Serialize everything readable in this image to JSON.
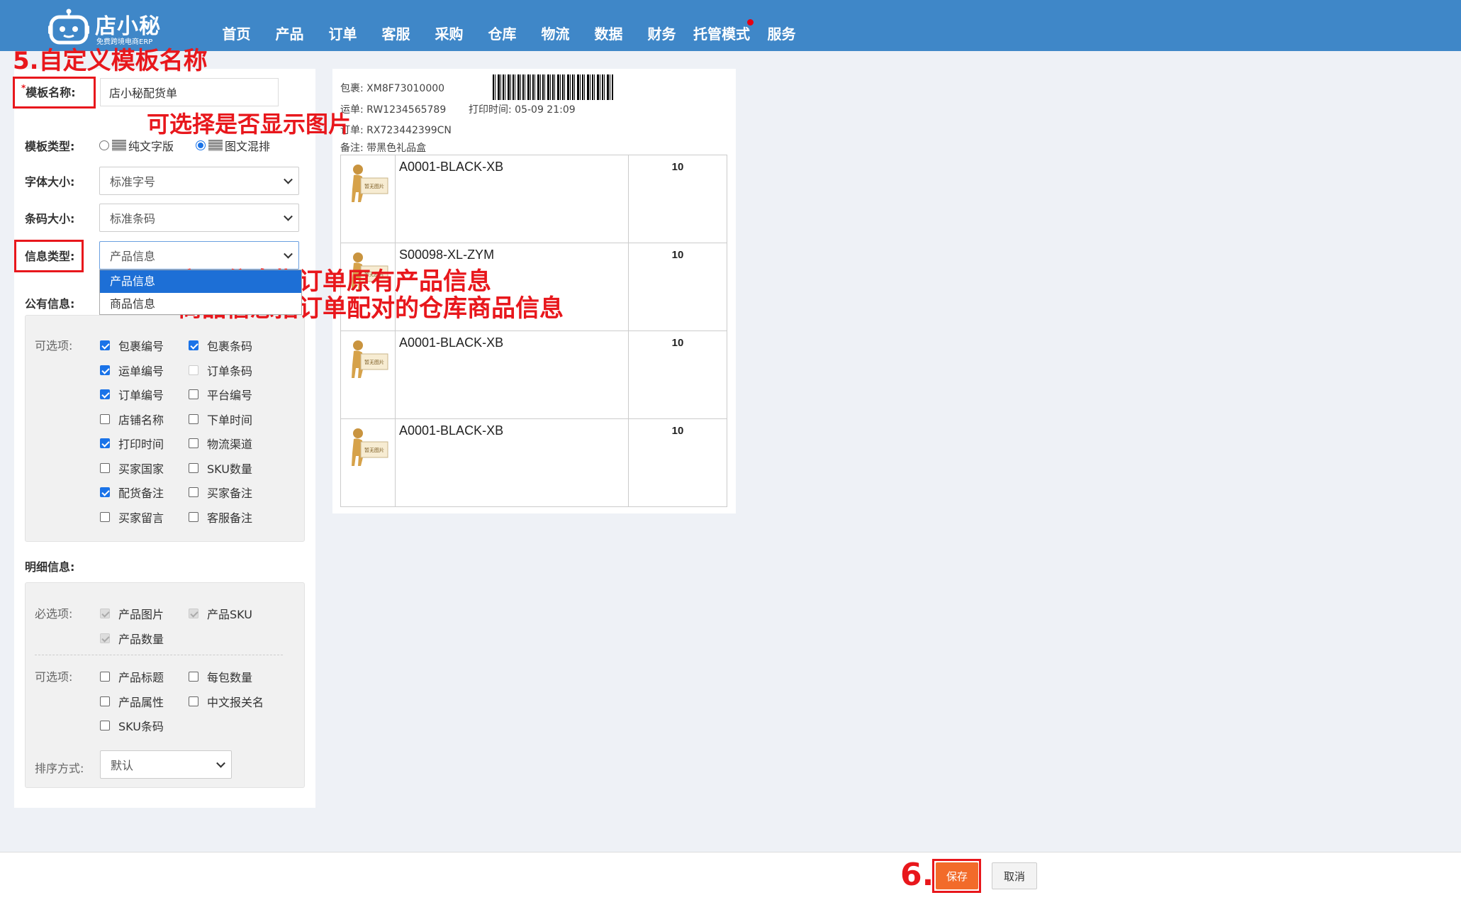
{
  "logo": {
    "name": "店小秘",
    "tagline": "免费跨境电商ERP"
  },
  "nav": [
    {
      "label": "首页"
    },
    {
      "label": "产品"
    },
    {
      "label": "订单"
    },
    {
      "label": "客服"
    },
    {
      "label": "采购"
    },
    {
      "label": "仓库"
    },
    {
      "label": "物流"
    },
    {
      "label": "数据"
    },
    {
      "label": "财务"
    },
    {
      "label": "托管模式",
      "dot": true
    },
    {
      "label": "服务"
    }
  ],
  "annotations": {
    "step5": "5.自定义模板名称",
    "show_image": "可选择是否显示图片",
    "info_line1": "产品信息指订单原有产品信息",
    "info_line2": "商品信息指订单配对的仓库商品信息",
    "step6": "6."
  },
  "form": {
    "template_name_label": "模板名称:",
    "template_name_required": "*",
    "template_name_value": "店小秘配货单",
    "template_type_label": "模板类型:",
    "template_type_options": [
      "纯文字版",
      "图文混排"
    ],
    "template_type_selected": "图文混排",
    "font_size_label": "字体大小:",
    "font_size_value": "标准字号",
    "barcode_size_label": "条码大小:",
    "barcode_size_value": "标准条码",
    "info_type_label": "信息类型:",
    "info_type_value": "产品信息",
    "info_type_options": [
      "产品信息",
      "商品信息"
    ],
    "public_info_label": "公有信息:",
    "public_optional_label": "可选项:",
    "public_options": [
      {
        "label": "包裹编号",
        "checked": true
      },
      {
        "label": "包裹条码",
        "checked": true
      },
      {
        "label": "运单编号",
        "checked": true
      },
      {
        "label": "订单条码",
        "checked": false
      },
      {
        "label": "订单编号",
        "checked": true
      },
      {
        "label": "平台编号",
        "checked": false
      },
      {
        "label": "店铺名称",
        "checked": false
      },
      {
        "label": "下单时间",
        "checked": false
      },
      {
        "label": "打印时间",
        "checked": true
      },
      {
        "label": "物流渠道",
        "checked": false
      },
      {
        "label": "买家国家",
        "checked": false
      },
      {
        "label": "SKU数量",
        "checked": false
      },
      {
        "label": "配货备注",
        "checked": true
      },
      {
        "label": "买家备注",
        "checked": false
      },
      {
        "label": "买家留言",
        "checked": false
      },
      {
        "label": "客服备注",
        "checked": false
      }
    ],
    "detail_info_label": "明细信息:",
    "required_label": "必选项:",
    "required_options": [
      "产品图片",
      "产品SKU",
      "产品数量"
    ],
    "detail_optional_label": "可选项:",
    "detail_options": [
      {
        "label": "产品标题",
        "checked": false
      },
      {
        "label": "每包数量",
        "checked": false
      },
      {
        "label": "产品属性",
        "checked": false
      },
      {
        "label": "中文报关名",
        "checked": false
      },
      {
        "label": "SKU条码",
        "checked": false
      }
    ],
    "sort_label": "排序方式:",
    "sort_value": "默认"
  },
  "preview": {
    "package_label": "包裹:",
    "package_value": "XM8F73010000",
    "waybill_label": "运单:",
    "waybill_value": "RW1234565789",
    "print_time_label": "打印时间:",
    "print_time_value": "05-09 21:09",
    "order_label": "订单:",
    "order_value": "RX723442399CN",
    "remark_label": "备注:",
    "remark_value": "带黑色礼品盒",
    "no_image_text": "暂无图片",
    "rows": [
      {
        "sku": "A0001-BLACK-XB",
        "qty": "10"
      },
      {
        "sku": "S00098-XL-ZYM",
        "qty": "10"
      },
      {
        "sku": "A0001-BLACK-XB",
        "qty": "10"
      },
      {
        "sku": "A0001-BLACK-XB",
        "qty": "10"
      }
    ]
  },
  "footer": {
    "save": "保存",
    "cancel": "取消"
  }
}
